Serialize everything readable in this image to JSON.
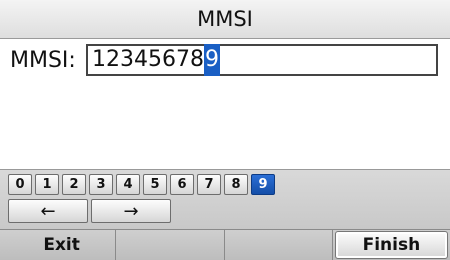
{
  "title": "MMSI",
  "field": {
    "label": "MMSI:",
    "value_before_cursor": "12345678",
    "cursor_char": "9"
  },
  "keypad": {
    "keys": [
      "0",
      "1",
      "2",
      "3",
      "4",
      "5",
      "6",
      "7",
      "8",
      "9"
    ],
    "selected_key": "9"
  },
  "arrows": {
    "left": "←",
    "right": "→"
  },
  "softkeys": {
    "exit": "Exit",
    "blank1": "",
    "blank2": "",
    "finish": "Finish"
  },
  "colors": {
    "accent": "#1a5fc4"
  }
}
